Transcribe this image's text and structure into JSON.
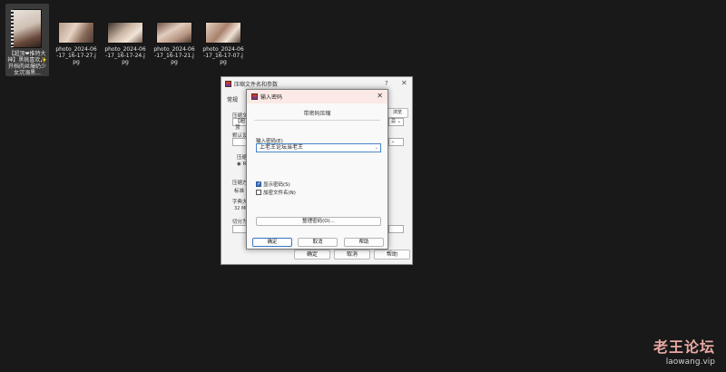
{
  "desktop": {
    "files": [
      {
        "name": "【超顶❤推特大神】黑桃喜欢✨ 开档肉丝爆奶少女沉溺黑..."
      },
      {
        "name": "photo_2024-06-17_16-17-27.jpg"
      },
      {
        "name": "photo_2024-06-17_16-17-24.jpg"
      },
      {
        "name": "photo_2024-06-17_16-17-21.jpg"
      },
      {
        "name": "photo_2024-06-17_16-17-07.jpg"
      }
    ]
  },
  "background_dialog": {
    "title": "压缩文件名和参数",
    "help_mark": "?",
    "close": "✕",
    "tab": "常规",
    "label_archive": "压缩文",
    "archive_value": "【超顶",
    "browse": "浏览(B)...",
    "label_default": "默认设",
    "label_format": "压缩",
    "format_option": "RA",
    "label_method": "压缩方",
    "method_value": "标准",
    "label_dict": "字典大",
    "dict_value": "32 MB",
    "label_split": "切分为",
    "btn_ok": "确定",
    "btn_cancel": "取消",
    "btn_help": "帮助"
  },
  "password_dialog": {
    "title": "输入密码",
    "close": "✕",
    "heading": "带密码压缩",
    "label": "输入密码(E)",
    "value": "上老王论坛当老王",
    "show_password": "显示密码(S)",
    "encrypt_names": "加密文件名(N)",
    "organize": "整理密码(O)...",
    "ok": "确定",
    "cancel": "取消",
    "help": "帮助"
  },
  "watermark": {
    "line1": "老王论坛",
    "line2": "laowang.vip"
  }
}
